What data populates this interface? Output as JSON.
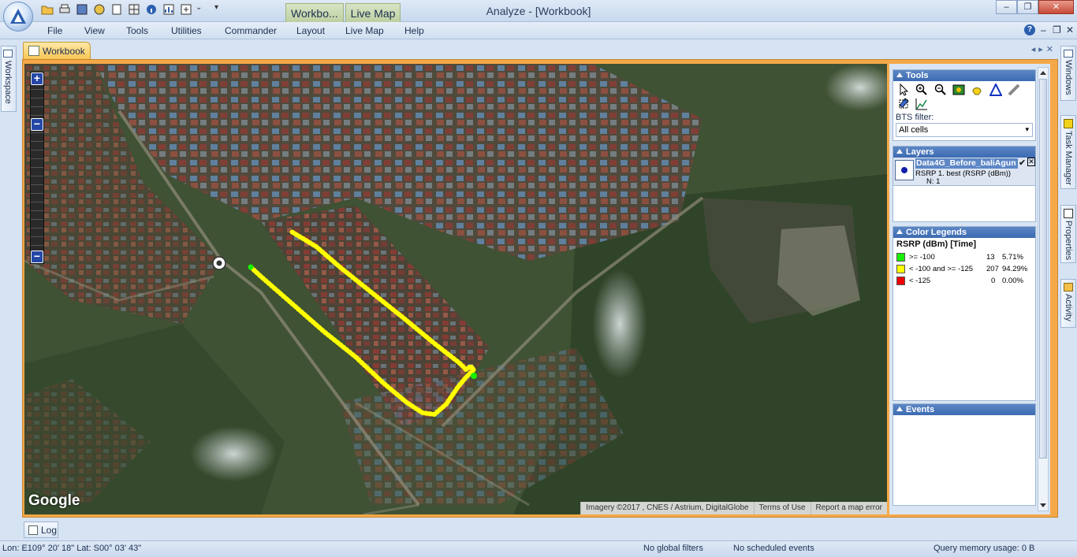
{
  "window": {
    "title": "Analyze - [Workbook]",
    "context_tabs": [
      "Workbo...",
      "Live Map"
    ],
    "minimize": "–",
    "restore": "❐",
    "close": "✕"
  },
  "menu": [
    "File",
    "View",
    "Tools",
    "Utilities",
    "Commander",
    "Layout",
    "Live Map",
    "Help"
  ],
  "left_dock": {
    "workspace": "Workspace"
  },
  "document_tab": {
    "label": "Workbook"
  },
  "map": {
    "provider_logo": "Google",
    "attribution": [
      "Imagery ©2017 , CNES / Astrium, DigitalGlobe",
      "Terms of Use",
      "Report a map error"
    ],
    "zoom_in": "+",
    "zoom_out": "−"
  },
  "tools": {
    "header": "Tools",
    "icons": [
      "pointer-icon",
      "zoom-in-icon",
      "zoom-out-icon",
      "zoom-extent-icon",
      "pan-icon",
      "bts-triangle-icon",
      "ruler-icon",
      "eraser-icon",
      "select-area-icon",
      "chart-icon"
    ],
    "bts_filter_label": "BTS filter:",
    "bts_filter_value": "All cells"
  },
  "layers": {
    "header": "Layers",
    "items": [
      {
        "name": "Data4G_Before_baliAgun",
        "metric": "RSRP 1. best (RSRP (dBm))",
        "n": "N: 1"
      }
    ]
  },
  "color_legends": {
    "header": "Color Legends",
    "title": "RSRP (dBm) [Time]",
    "entries": [
      {
        "color": "#18f000",
        "label": ">= -100",
        "count": "13",
        "percent": "5.71%"
      },
      {
        "color": "#ffff00",
        "label": "< -100 and >= -125",
        "count": "207",
        "percent": "94.29%"
      },
      {
        "color": "#f00000",
        "label": "< -125",
        "count": "0",
        "percent": "0.00%"
      }
    ]
  },
  "events": {
    "header": "Events"
  },
  "right_dock": [
    "Windows",
    "Task Manager",
    "Properties",
    "Activity"
  ],
  "log_tab": {
    "label": "Log"
  },
  "status": {
    "coords": "Lon: E109° 20' 18\" Lat: S00° 03' 43\"",
    "filters": "No global filters",
    "events": "No scheduled events",
    "memory": "Query memory usage: 0 B"
  },
  "colors": {
    "accent": "#f5a848",
    "section_header": "#3c6bb2",
    "route_yellow": "#ffff00",
    "route_green": "#18f000"
  }
}
